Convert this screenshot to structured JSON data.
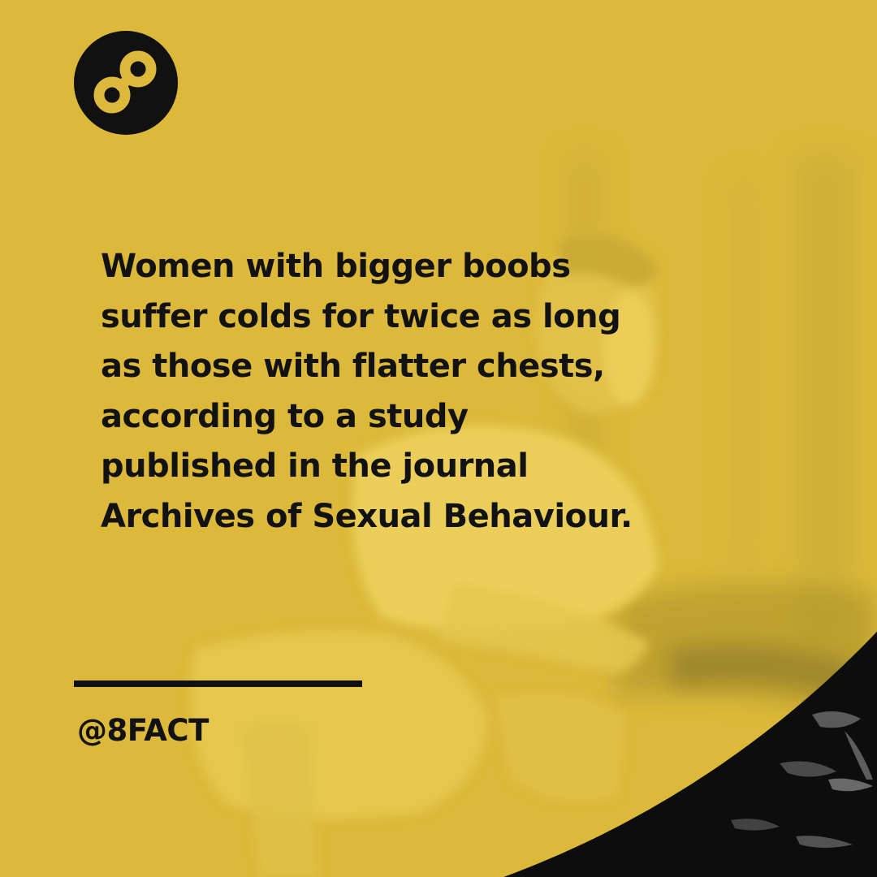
{
  "post": {
    "fact": "Women with bigger boobs suffer colds for twice as long as those with flatter chests, according to a study published in the journal Archives of Sexual Behaviour.",
    "handle": "@8FACT"
  },
  "brand": {
    "logo_icon": "infinity-eight-icon",
    "background_color": "#dcb93a",
    "badge_color": "#111111",
    "text_color": "#121212"
  }
}
